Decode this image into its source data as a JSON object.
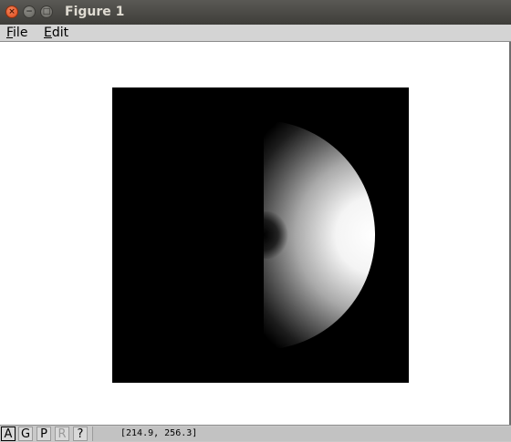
{
  "window": {
    "title": "Figure 1",
    "close_glyph": "×",
    "minimize_glyph": "−",
    "maximize_glyph": "□"
  },
  "menu": {
    "items": [
      {
        "mnemonic": "F",
        "rest": "ile"
      },
      {
        "mnemonic": "E",
        "rest": "dit"
      }
    ]
  },
  "figure": {
    "background": "#000000",
    "content": "shaded crescent sphere (lit from right)"
  },
  "statusbar": {
    "buttons": [
      {
        "label": "A",
        "state": "active"
      },
      {
        "label": "G",
        "state": "normal"
      },
      {
        "label": "P",
        "state": "normal"
      },
      {
        "label": "R",
        "state": "disabled"
      },
      {
        "label": "?",
        "state": "normal"
      }
    ],
    "coordinates": "[214.9, 256.3]"
  },
  "colors": {
    "titlebar": "#3e3d39",
    "title_text": "#dfdbd2",
    "close_button": "#df4a1b",
    "menubar": "#d4d4d4",
    "statusbar": "#c9c9c9"
  }
}
